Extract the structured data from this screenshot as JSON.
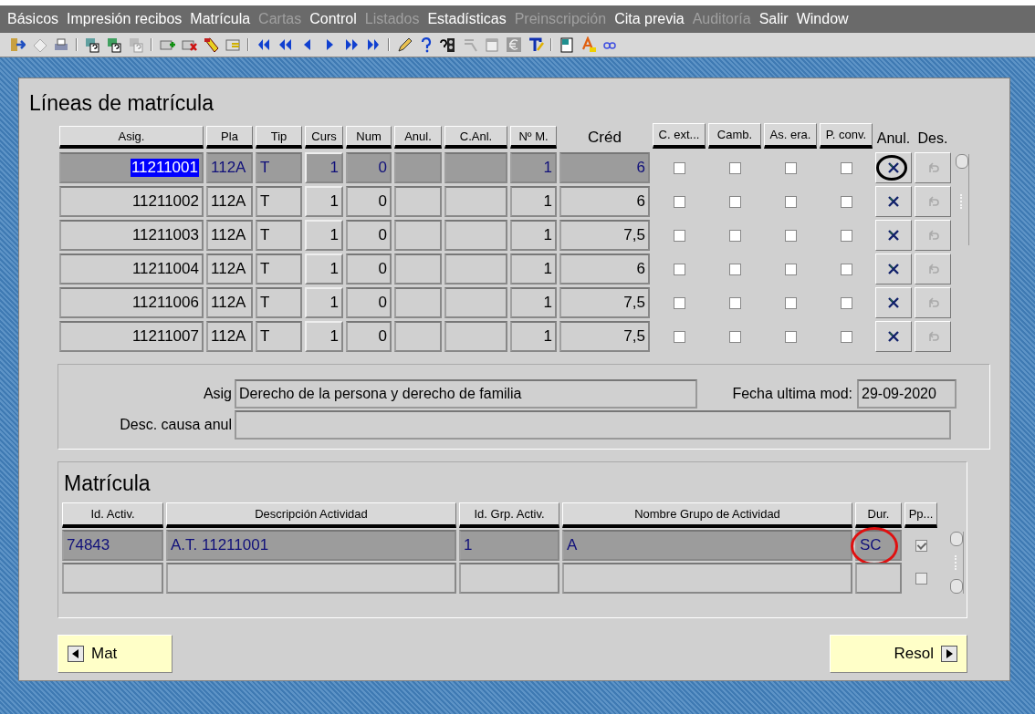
{
  "menu": [
    {
      "label": "Básicos",
      "disabled": false
    },
    {
      "label": "Impresión recibos",
      "disabled": false
    },
    {
      "label": "Matrícula",
      "disabled": false
    },
    {
      "label": "Cartas",
      "disabled": true
    },
    {
      "label": "Control",
      "disabled": false
    },
    {
      "label": "Listados",
      "disabled": true
    },
    {
      "label": "Estadísticas",
      "disabled": false
    },
    {
      "label": "Preinscripción",
      "disabled": true
    },
    {
      "label": "Cita previa",
      "disabled": false
    },
    {
      "label": "Auditoría",
      "disabled": true
    },
    {
      "label": "Salir",
      "disabled": false
    },
    {
      "label": "Window",
      "disabled": false
    }
  ],
  "lineas": {
    "title": "Líneas de matrícula",
    "columns": [
      {
        "label": "Asig.",
        "kind": "button"
      },
      {
        "label": "Pla",
        "kind": "button"
      },
      {
        "label": "Tip",
        "kind": "button"
      },
      {
        "label": "Curs",
        "kind": "button"
      },
      {
        "label": "Num",
        "kind": "button"
      },
      {
        "label": "Anul.",
        "kind": "button"
      },
      {
        "label": "C.Anl.",
        "kind": "button"
      },
      {
        "label": "Nº M.",
        "kind": "button"
      },
      {
        "label": "Créd",
        "kind": "plain"
      },
      {
        "label": "C. ext...",
        "kind": "button"
      },
      {
        "label": "Camb.",
        "kind": "button"
      },
      {
        "label": "As. era.",
        "kind": "button"
      },
      {
        "label": "P. conv.",
        "kind": "button"
      },
      {
        "label": "Anul.",
        "kind": "plain"
      },
      {
        "label": "Des.",
        "kind": "plain"
      }
    ],
    "rows": [
      {
        "selected": true,
        "asig": "11211001",
        "pla": "112A",
        "tip": "T",
        "curs": "1",
        "num": "0",
        "n_m": "1",
        "cred": "6",
        "checks": [
          false,
          false,
          false,
          false
        ],
        "undo_disabled": true,
        "circled": true
      },
      {
        "selected": false,
        "asig": "11211002",
        "pla": "112A",
        "tip": "T",
        "curs": "1",
        "num": "0",
        "n_m": "1",
        "cred": "6",
        "checks": [
          false,
          false,
          false,
          false
        ],
        "undo_disabled": true,
        "circled": false
      },
      {
        "selected": false,
        "asig": "11211003",
        "pla": "112A",
        "tip": "T",
        "curs": "1",
        "num": "0",
        "n_m": "1",
        "cred": "7,5",
        "checks": [
          false,
          false,
          false,
          false
        ],
        "undo_disabled": true,
        "circled": false
      },
      {
        "selected": false,
        "asig": "11211004",
        "pla": "112A",
        "tip": "T",
        "curs": "1",
        "num": "0",
        "n_m": "1",
        "cred": "6",
        "checks": [
          false,
          false,
          false,
          false
        ],
        "undo_disabled": true,
        "circled": false
      },
      {
        "selected": false,
        "asig": "11211006",
        "pla": "112A",
        "tip": "T",
        "curs": "1",
        "num": "0",
        "n_m": "1",
        "cred": "7,5",
        "checks": [
          false,
          false,
          false,
          false
        ],
        "undo_disabled": true,
        "circled": false
      },
      {
        "selected": false,
        "asig": "11211007",
        "pla": "112A",
        "tip": "T",
        "curs": "1",
        "num": "0",
        "n_m": "1",
        "cred": "7,5",
        "checks": [
          false,
          false,
          false,
          false
        ],
        "undo_disabled": true,
        "circled": false
      }
    ]
  },
  "detail": {
    "asig_label": "Asig",
    "asig_value": "Derecho de la persona y derecho de familia",
    "fecha_label": "Fecha ultima mod:",
    "fecha_value": "29-09-2020",
    "desc_label": "Desc. causa anul"
  },
  "matricula": {
    "title": "Matrícula",
    "columns": [
      "Id. Activ.",
      "Descripción Actividad",
      "Id. Grp. Activ.",
      "Nombre Grupo de Actividad",
      "Dur.",
      "Pp..."
    ],
    "rows": [
      {
        "selected": true,
        "id_activ": "74843",
        "descripcion": "A.T. 11211001",
        "id_grp": "1",
        "nombre_grupo": "A",
        "dur": "SC",
        "pp_checked": true,
        "circled": true
      },
      {
        "selected": false,
        "pp_checked": false,
        "circled": false
      }
    ]
  },
  "buttons": [
    {
      "label": "Mat",
      "kind": "back"
    },
    {
      "label": "Resol",
      "kind": "forward"
    }
  ]
}
